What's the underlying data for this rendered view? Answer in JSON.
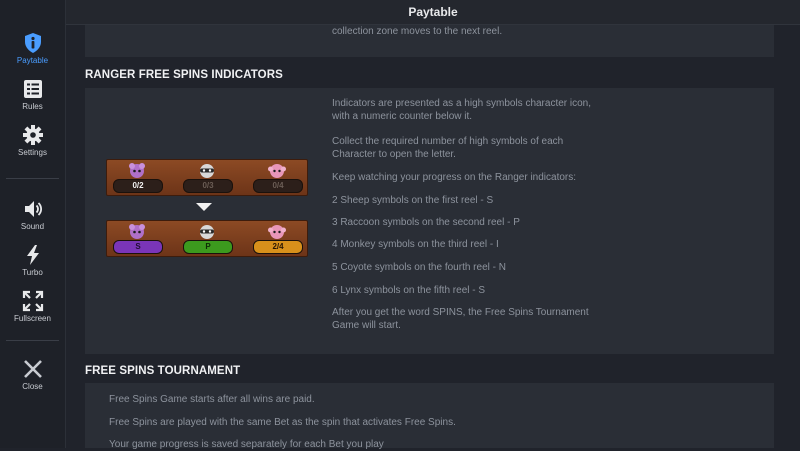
{
  "header": {
    "title": "Paytable"
  },
  "sidebar": {
    "items": [
      {
        "label": "Paytable",
        "icon": "info-icon",
        "active": true
      },
      {
        "label": "Rules",
        "icon": "list-icon"
      },
      {
        "label": "Settings",
        "icon": "gear-icon"
      },
      {
        "label": "Sound",
        "icon": "speaker-icon"
      },
      {
        "label": "Turbo",
        "icon": "lightning-icon"
      },
      {
        "label": "Fullscreen",
        "icon": "expand-icon"
      },
      {
        "label": "Close",
        "icon": "close-icon"
      }
    ]
  },
  "top_panel": {
    "text": "collection zone moves to the next reel."
  },
  "ranger_section": {
    "title": "RANGER FREE SPINS INDICATORS",
    "paragraphs": [
      "Indicators are presented as a high symbols character icon,",
      "with a numeric counter below it.",
      "Collect the required number of high symbols of each",
      "Character to open the letter.",
      "Keep watching your progress on the Ranger indicators:",
      "2 Sheep symbols on the first reel - S",
      "3 Raccoon symbols on the second reel - P",
      "4 Monkey symbols on the third reel - I",
      "5 Coyote symbols on the fourth reel - N",
      "6 Lynx symbols on the fifth reel - S",
      "After you get the word SPINS, the Free Spins Tournament",
      "Game will start."
    ],
    "indicators_before": [
      "0/2",
      "0/3",
      "0/4"
    ],
    "indicators_after": [
      "S",
      "P",
      "2/4"
    ]
  },
  "tournament_section": {
    "title": "FREE SPINS TOURNAMENT",
    "paragraphs": [
      "Free Spins Game starts after all wins are paid.",
      "Free Spins are played with the same Bet as the spin that activates Free Spins.",
      "Your game progress is saved separately for each Bet you play"
    ]
  },
  "colors": {
    "accent": "#4a9dff",
    "background": "#20232b",
    "panel": "#2a2e36",
    "text_muted": "#8d939d",
    "strip_wood": "#8c4a24"
  }
}
